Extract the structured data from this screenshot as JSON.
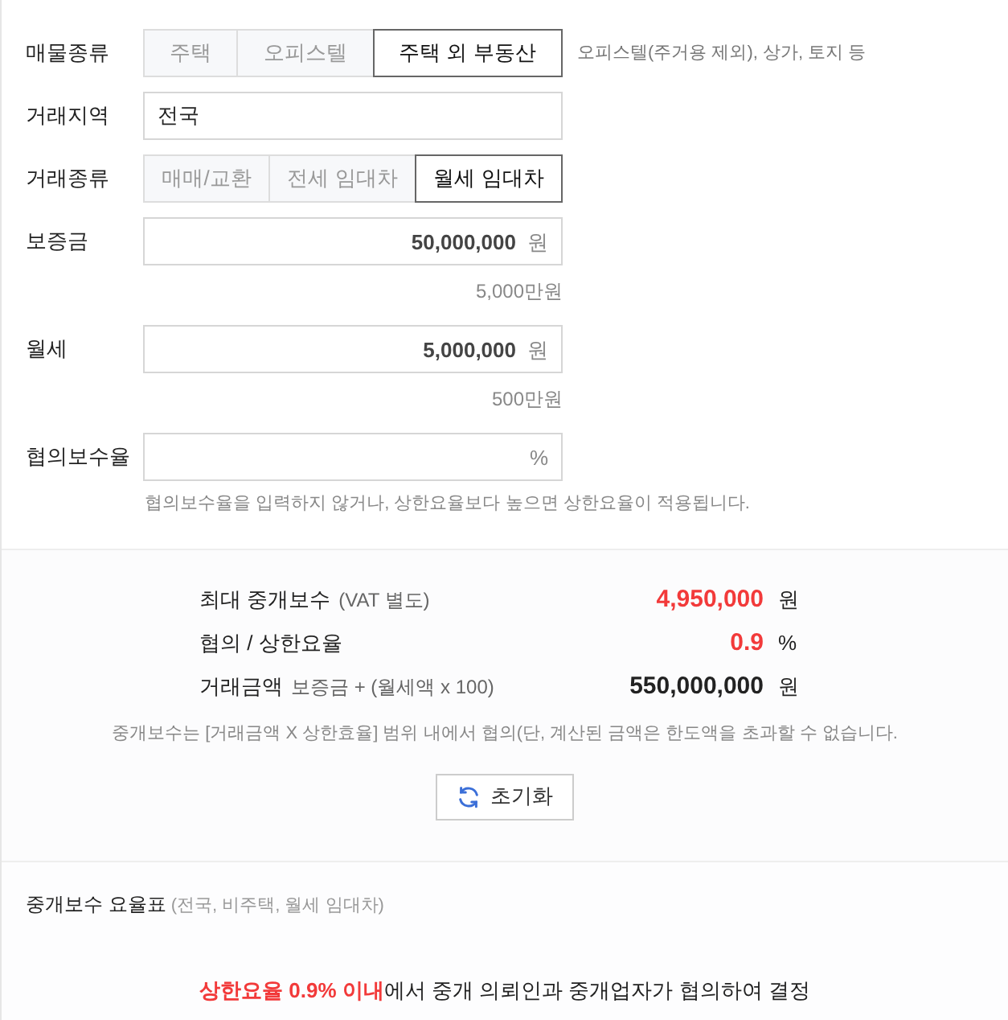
{
  "fields": [
    {
      "kind": "segmented",
      "label": "매물종류",
      "options": [
        {
          "label": "주택",
          "selected": false
        },
        {
          "label": "오피스텔",
          "selected": false
        },
        {
          "label": "주택 외 부동산",
          "selected": true
        }
      ],
      "hint": "오피스텔(주거용 제외), 상가, 토지 등"
    },
    {
      "kind": "text",
      "label": "거래지역",
      "value": "전국"
    },
    {
      "kind": "segmented",
      "label": "거래종류",
      "options": [
        {
          "label": "매매/교환",
          "selected": false
        },
        {
          "label": "전세 임대차",
          "selected": false
        },
        {
          "label": "월세 임대차",
          "selected": true
        }
      ]
    },
    {
      "kind": "amount",
      "label": "보증금",
      "value": "50,000,000",
      "unit": "원",
      "note": "5,000만원"
    },
    {
      "kind": "amount",
      "label": "월세",
      "value": "5,000,000",
      "unit": "원",
      "note": "500만원"
    },
    {
      "kind": "amount",
      "label": "협의보수율",
      "unit": "%",
      "help": "협의보수율을 입력하지 않거나, 상한요율보다 높으면 상한요율이 적용됩니다."
    }
  ],
  "summary": {
    "rows": [
      {
        "label": "최대 중개보수",
        "sub": "(VAT 별도)",
        "value": "4,950,000",
        "unit": "원",
        "highlight": true
      },
      {
        "label": "협의 / 상한요율",
        "value": "0.9",
        "unit": "%",
        "highlight": true
      },
      {
        "label": "거래금액",
        "sub": "보증금 + (월세액 x 100)",
        "value": "550,000,000",
        "unit": "원",
        "highlight": false
      }
    ],
    "note": "중개보수는 [거래금액 X 상한효율] 범위 내에서 협의(단, 계산된 금액은 한도액을 초과할 수 없습니다.",
    "reset_button": "초기화"
  },
  "rate_table": {
    "title": "중개보수 요율표",
    "subtitle": "(전국, 비주택, 월세 임대차)",
    "rule": "**상한요율 0.9% 이내**에서 중개 의뢰인과 중개업자가 협의하여 결정"
  }
}
